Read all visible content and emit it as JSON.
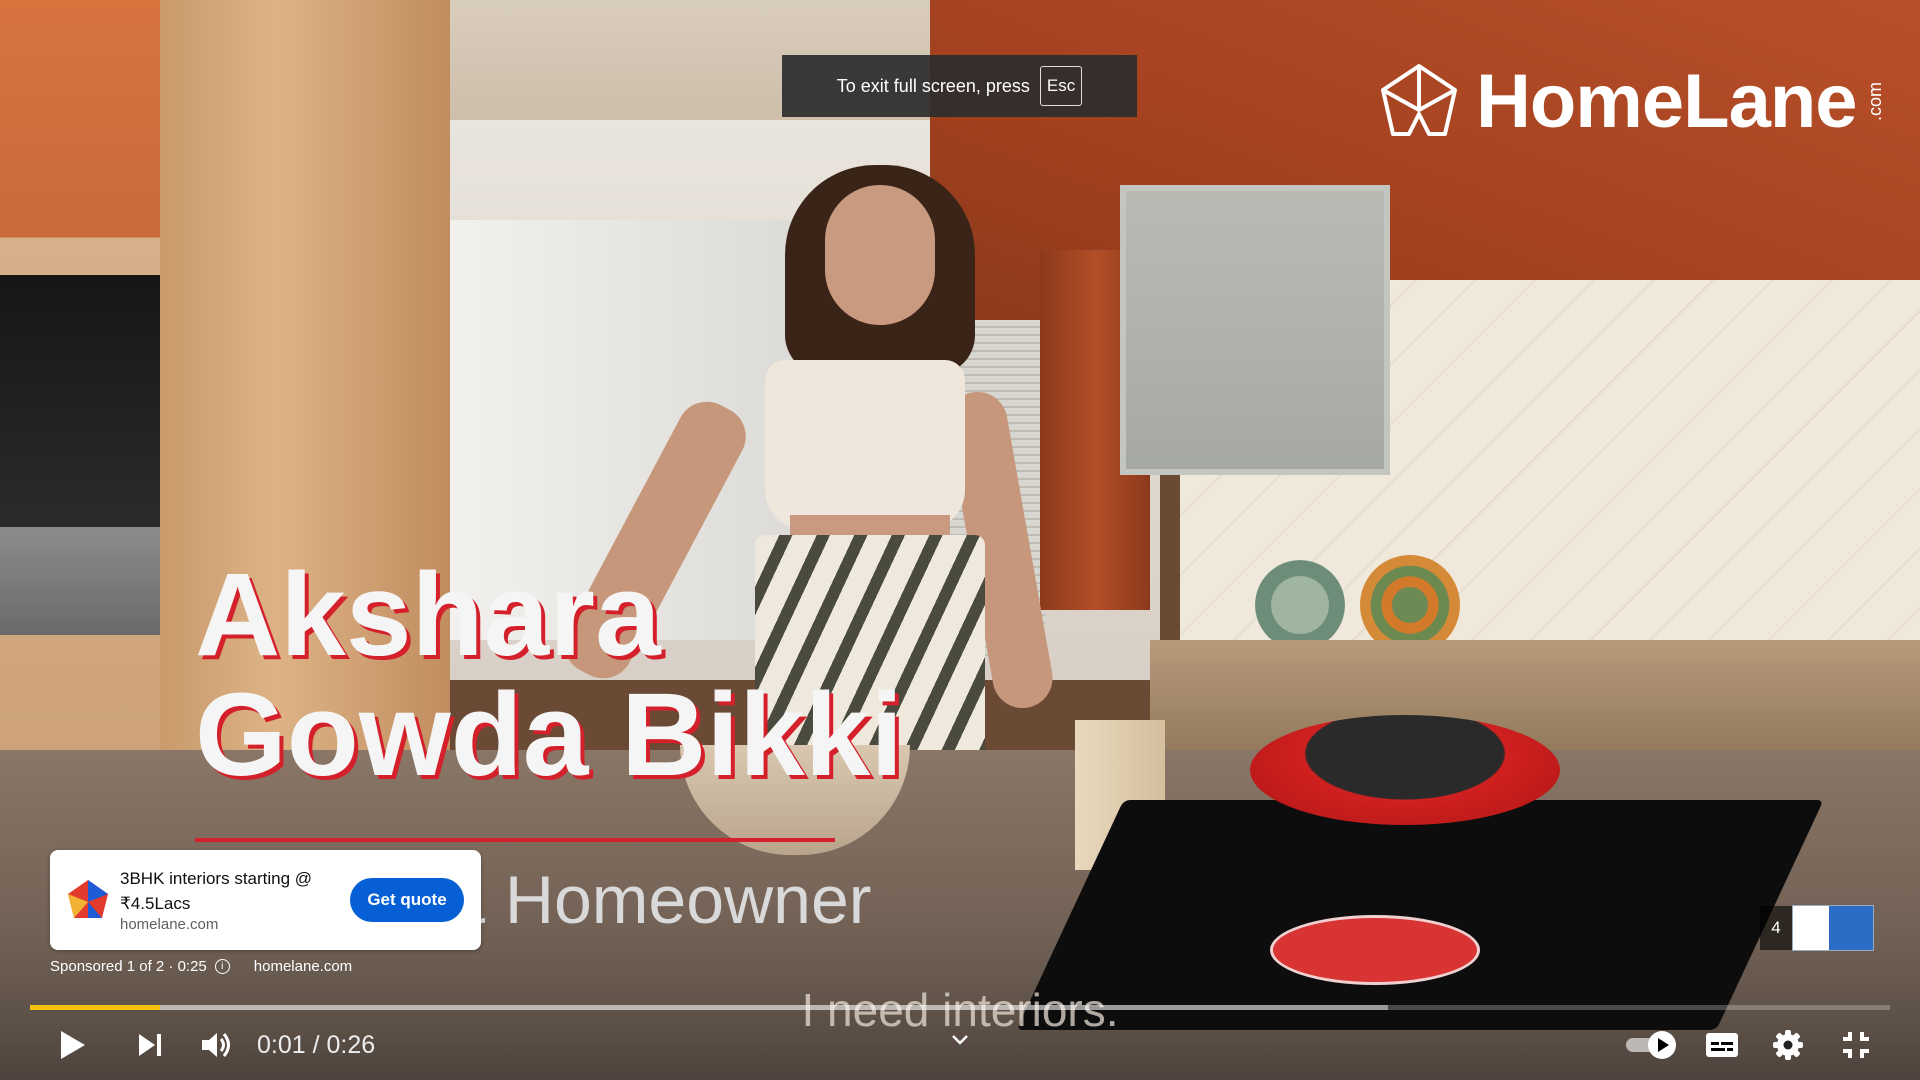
{
  "fullscreen_notice": {
    "text": "To exit full screen, press",
    "key": "Esc"
  },
  "brand": {
    "name": "HomeLane",
    "suffix": ".com"
  },
  "title_card": {
    "name_line1": "Akshara",
    "name_line2": "Gowda Bikki",
    "role": "Actress & Homeowner"
  },
  "caption": "I need interiors.",
  "ad": {
    "headline": "3BHK interiors starting @ ₹4.5Lacs",
    "domain": "homelane.com",
    "cta_label": "Get quote",
    "sponsored_text": "Sponsored 1 of 2 · 0:25",
    "link_text": "homelane.com"
  },
  "up_next": {
    "count": "4"
  },
  "player": {
    "current_time": "0:01",
    "duration": "0:26",
    "time_display": "0:01 / 0:26",
    "progress_played_fraction": 0.07,
    "progress_buffered_fraction": 0.73,
    "accent_color": "#f4c20d",
    "cta_color": "#065fd4"
  },
  "icons": {
    "play": "play-icon",
    "next": "skip-next-icon",
    "volume": "volume-icon",
    "autoplay": "autoplay-toggle",
    "subtitles": "subtitles-icon",
    "settings": "gear-icon",
    "exit_fullscreen": "exit-fullscreen-icon",
    "chevron": "chevron-down-icon",
    "info": "info-icon"
  }
}
